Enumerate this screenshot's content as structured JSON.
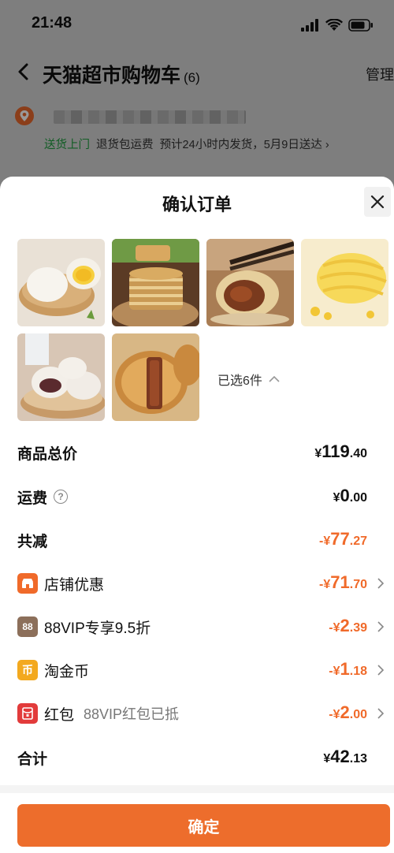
{
  "status_bar": {
    "time": "21:48"
  },
  "header": {
    "title": "天猫超市购物车",
    "count": "(6)",
    "manage": "管理"
  },
  "delivery": {
    "tag": "送货上门",
    "return_policy": "退货包运费",
    "estimate": "预计24小时内发货，5月9日送达"
  },
  "sheet": {
    "title": "确认订单",
    "selected_label": "已选6件",
    "products": [
      {
        "name": "custard-bun-thumb"
      },
      {
        "name": "layered-pancake-thumb"
      },
      {
        "name": "meat-dumpling-thumb"
      },
      {
        "name": "corn-bun-thumb"
      },
      {
        "name": "red-bean-bun-thumb"
      },
      {
        "name": "meat-pie-thumb"
      }
    ],
    "summary": [
      {
        "key": "goods_total",
        "label": "商品总价",
        "yen": "¥",
        "int": "119",
        "dec": ".40",
        "orange": false,
        "bold": true
      },
      {
        "key": "shipping",
        "label": "运费",
        "yen": "¥",
        "int": "0",
        "dec": ".00",
        "orange": false,
        "bold": true,
        "help": "?"
      },
      {
        "key": "total_reduction",
        "label": "共减",
        "yen": "-¥",
        "int": "77",
        "dec": ".27",
        "orange": true,
        "bold": true
      },
      {
        "key": "store_discount",
        "label": "店铺优惠",
        "yen": "-¥",
        "int": "71",
        "dec": ".70",
        "orange": true,
        "bold": false,
        "badge": "shop",
        "chevron": true
      },
      {
        "key": "vip_discount",
        "label": "88VIP专享9.5折",
        "yen": "-¥",
        "int": "2",
        "dec": ".39",
        "orange": true,
        "bold": false,
        "badge": "88",
        "chevron": true
      },
      {
        "key": "coins",
        "label": "淘金币",
        "yen": "-¥",
        "int": "1",
        "dec": ".18",
        "orange": true,
        "bold": false,
        "badge": "币",
        "chevron": true
      },
      {
        "key": "red_packet",
        "label": "红包",
        "sub": "88VIP红包已抵",
        "yen": "-¥",
        "int": "2",
        "dec": ".00",
        "orange": true,
        "bold": false,
        "badge": "packet",
        "chevron": true
      },
      {
        "key": "grand_total",
        "label": "合计",
        "yen": "¥",
        "int": "42",
        "dec": ".13",
        "orange": false,
        "bold": true
      }
    ],
    "confirm_label": "确定"
  },
  "colors": {
    "accent": "#ed6d2c",
    "discount_text": "#f06a2a",
    "green": "#1f9b3f"
  }
}
